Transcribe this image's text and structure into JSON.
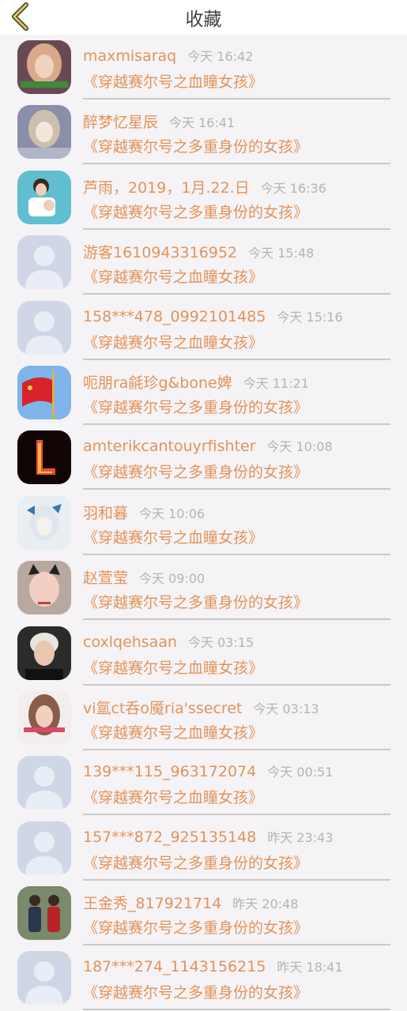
{
  "header": {
    "title": "收藏",
    "back_icon": "chevron-left-icon",
    "accent": "#e2c84a"
  },
  "items": [
    {
      "name": "maxmisaraq",
      "time": "今天 16:42",
      "book": "《穿越赛尔号之血瞳女孩》",
      "avatar": "photo-girl-1"
    },
    {
      "name": "醉梦忆星辰",
      "time": "今天 16:41",
      "book": "《穿越赛尔号之多重身份的女孩》",
      "avatar": "anime-girl"
    },
    {
      "name": "芦雨，2019，1月.22.日",
      "time": "今天 16:36",
      "book": "《穿越赛尔号之多重身份的女孩》",
      "avatar": "photo-mother-child"
    },
    {
      "name": "游客1610943316952",
      "time": "今天 15:48",
      "book": "《穿越赛尔号之血瞳女孩》",
      "avatar": "default-avatar"
    },
    {
      "name": "158***478_0992101485",
      "time": "今天 15:16",
      "book": "《穿越赛尔号之血瞳女孩》",
      "avatar": "default-avatar"
    },
    {
      "name": "呃朋ra毹珍g&bone婢",
      "time": "今天 11:21",
      "book": "《穿越赛尔号之多重身份的女孩》",
      "avatar": "flag"
    },
    {
      "name": "amterikcantouyrfishter",
      "time": "今天 10:08",
      "book": "《穿越赛尔号之多重身份的女孩》",
      "avatar": "fire-letter"
    },
    {
      "name": "羽和暮",
      "time": "今天 10:06",
      "book": "《穿越赛尔号之血瞳女孩》",
      "avatar": "anime-butterfly"
    },
    {
      "name": "赵萱莹",
      "time": "今天 09:00",
      "book": "《穿越赛尔号之多重身份的女孩》",
      "avatar": "photo-cat-girl"
    },
    {
      "name": "coxlqehsaan",
      "time": "今天 03:15",
      "book": "《穿越赛尔号之血瞳女孩》",
      "avatar": "photo-boy"
    },
    {
      "name": "vi氲ct呑o魇ria'ssecret",
      "time": "今天 03:13",
      "book": "《穿越赛尔号之血瞳女孩》",
      "avatar": "photo-girl-2"
    },
    {
      "name": "139***115_963172074",
      "time": "今天 00:51",
      "book": "《穿越赛尔号之血瞳女孩》",
      "avatar": "default-avatar"
    },
    {
      "name": "157***872_925135148",
      "time": "昨天 23:43",
      "book": "《穿越赛尔号之多重身份的女孩》",
      "avatar": "default-avatar"
    },
    {
      "name": "王金秀_817921714",
      "time": "昨天 20:48",
      "book": "《穿越赛尔号之多重身份的女孩》",
      "avatar": "photo-couple"
    },
    {
      "name": "187***274_1143156215",
      "time": "昨天 18:41",
      "book": "《穿越赛尔号之多重身份的女孩》",
      "avatar": "default-avatar"
    }
  ]
}
